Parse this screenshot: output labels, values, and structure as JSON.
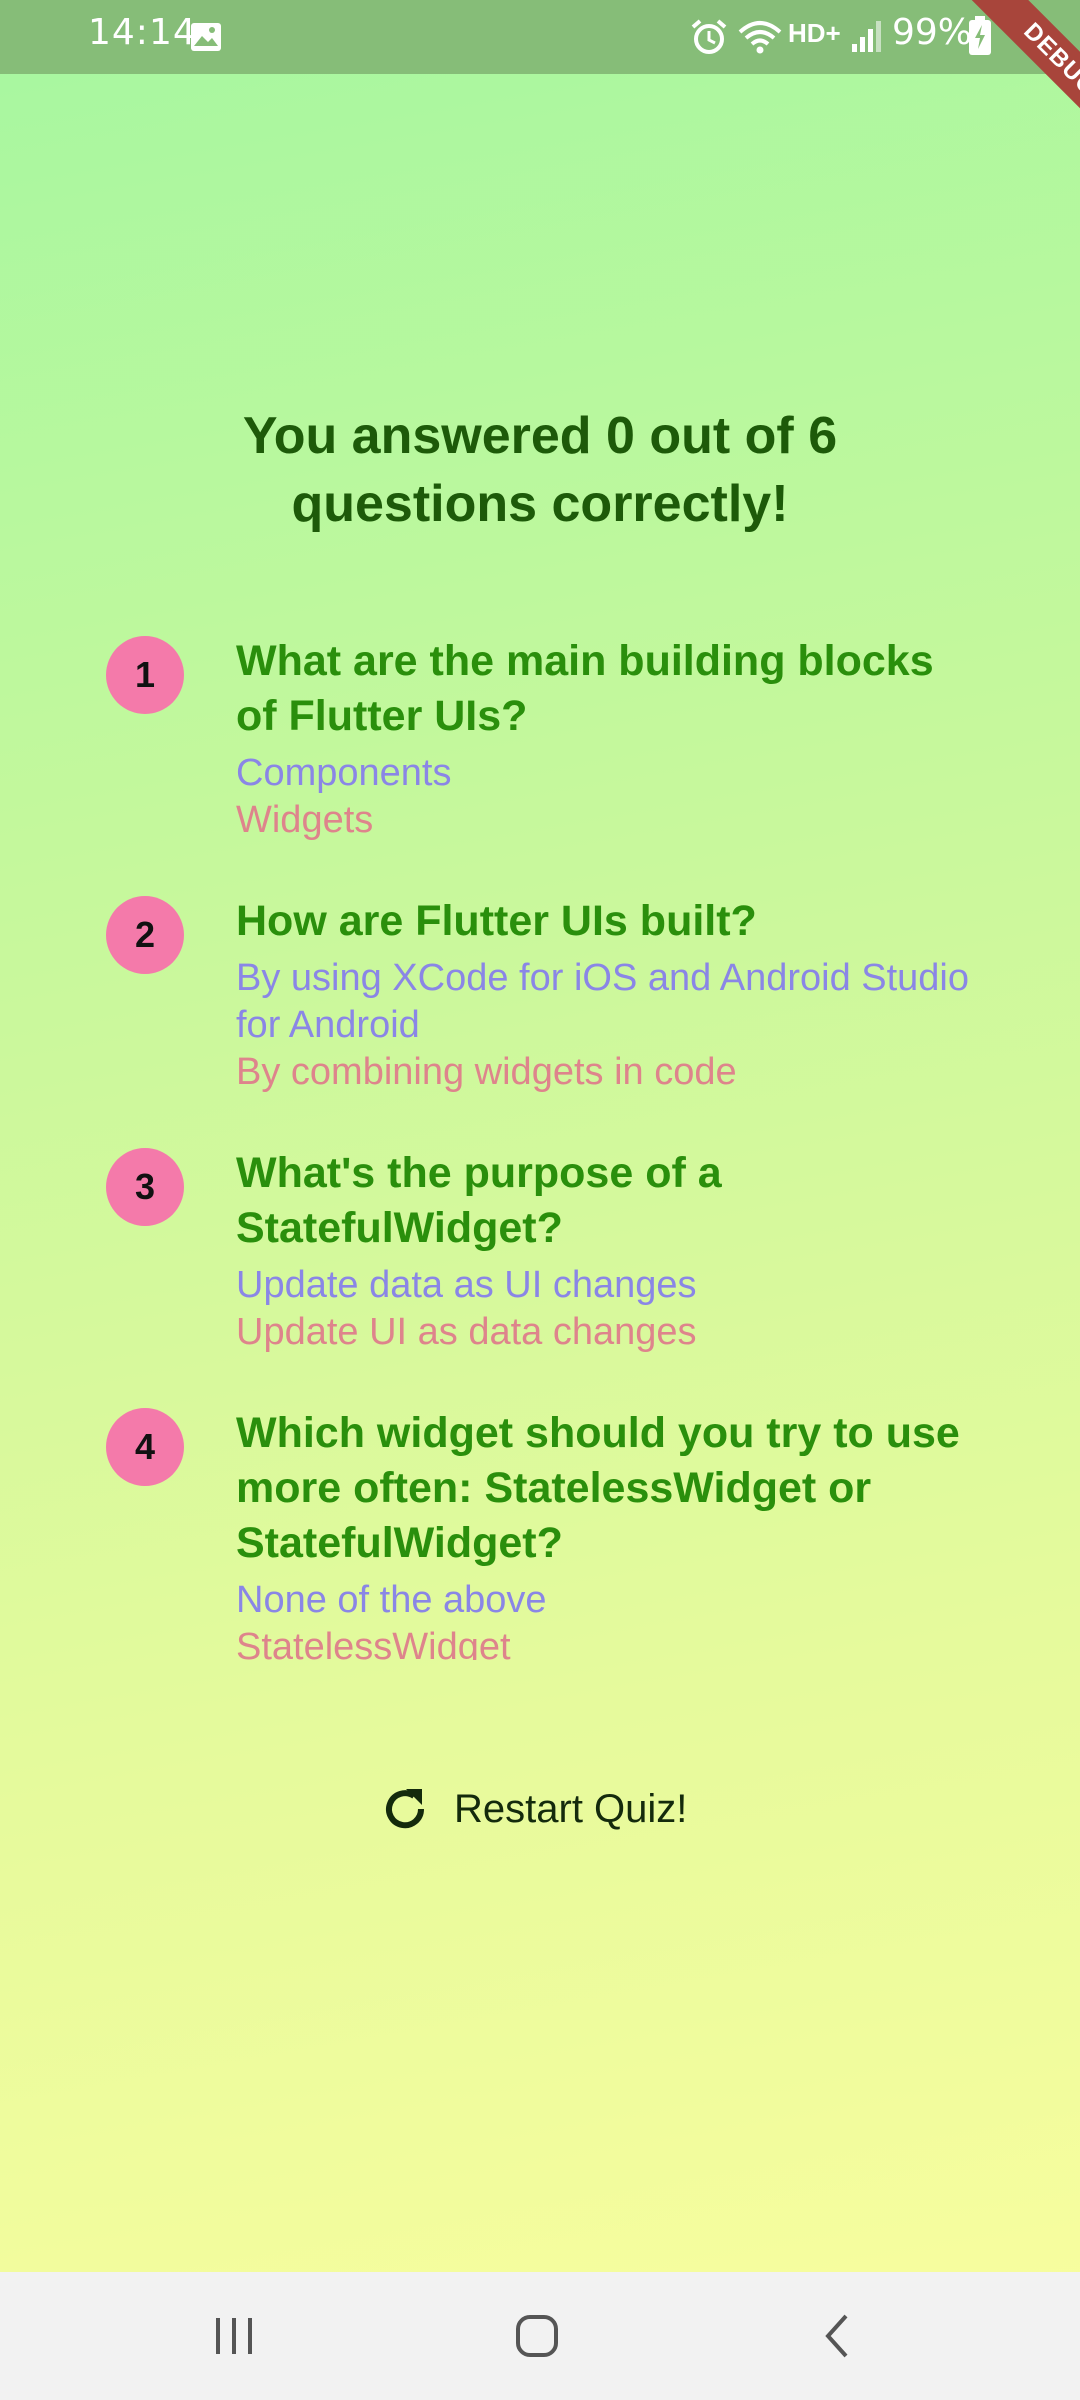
{
  "status_bar": {
    "time": "14:14",
    "network": "HD+",
    "battery": "99%",
    "icons": [
      "image-icon",
      "alarm-icon",
      "wifi-icon",
      "signal-icon",
      "battery-charging-icon"
    ]
  },
  "debug_banner": "DEBUG",
  "result": {
    "title": "You answered 0 out of 6 questions correctly!"
  },
  "summary": [
    {
      "number": "1",
      "question": "What are the main building blocks of Flutter UIs?",
      "user_answer": "Components",
      "correct_answer": "Widgets"
    },
    {
      "number": "2",
      "question": "How are Flutter UIs built?",
      "user_answer": "By using XCode for iOS and Android Studio for Android",
      "correct_answer": "By combining widgets in code"
    },
    {
      "number": "3",
      "question": "What's the purpose of a StatefulWidget?",
      "user_answer": "Update data as UI changes",
      "correct_answer": "Update UI as data changes"
    },
    {
      "number": "4",
      "question": "Which widget should you try to use more often: StatelessWidget or StatefulWidget?",
      "user_answer": "None of the above",
      "correct_answer": "StatelessWidget"
    }
  ],
  "restart": {
    "label": "Restart Quiz!",
    "icon": "refresh-icon"
  },
  "nav": {
    "icons": [
      "recent-apps-icon",
      "home-icon",
      "back-icon"
    ]
  },
  "colors": {
    "question": "#2a8f0c",
    "user_answer": "#8a86e6",
    "correct_answer": "#de848c",
    "badge": "#f47aaa",
    "title": "#1d5a09"
  }
}
